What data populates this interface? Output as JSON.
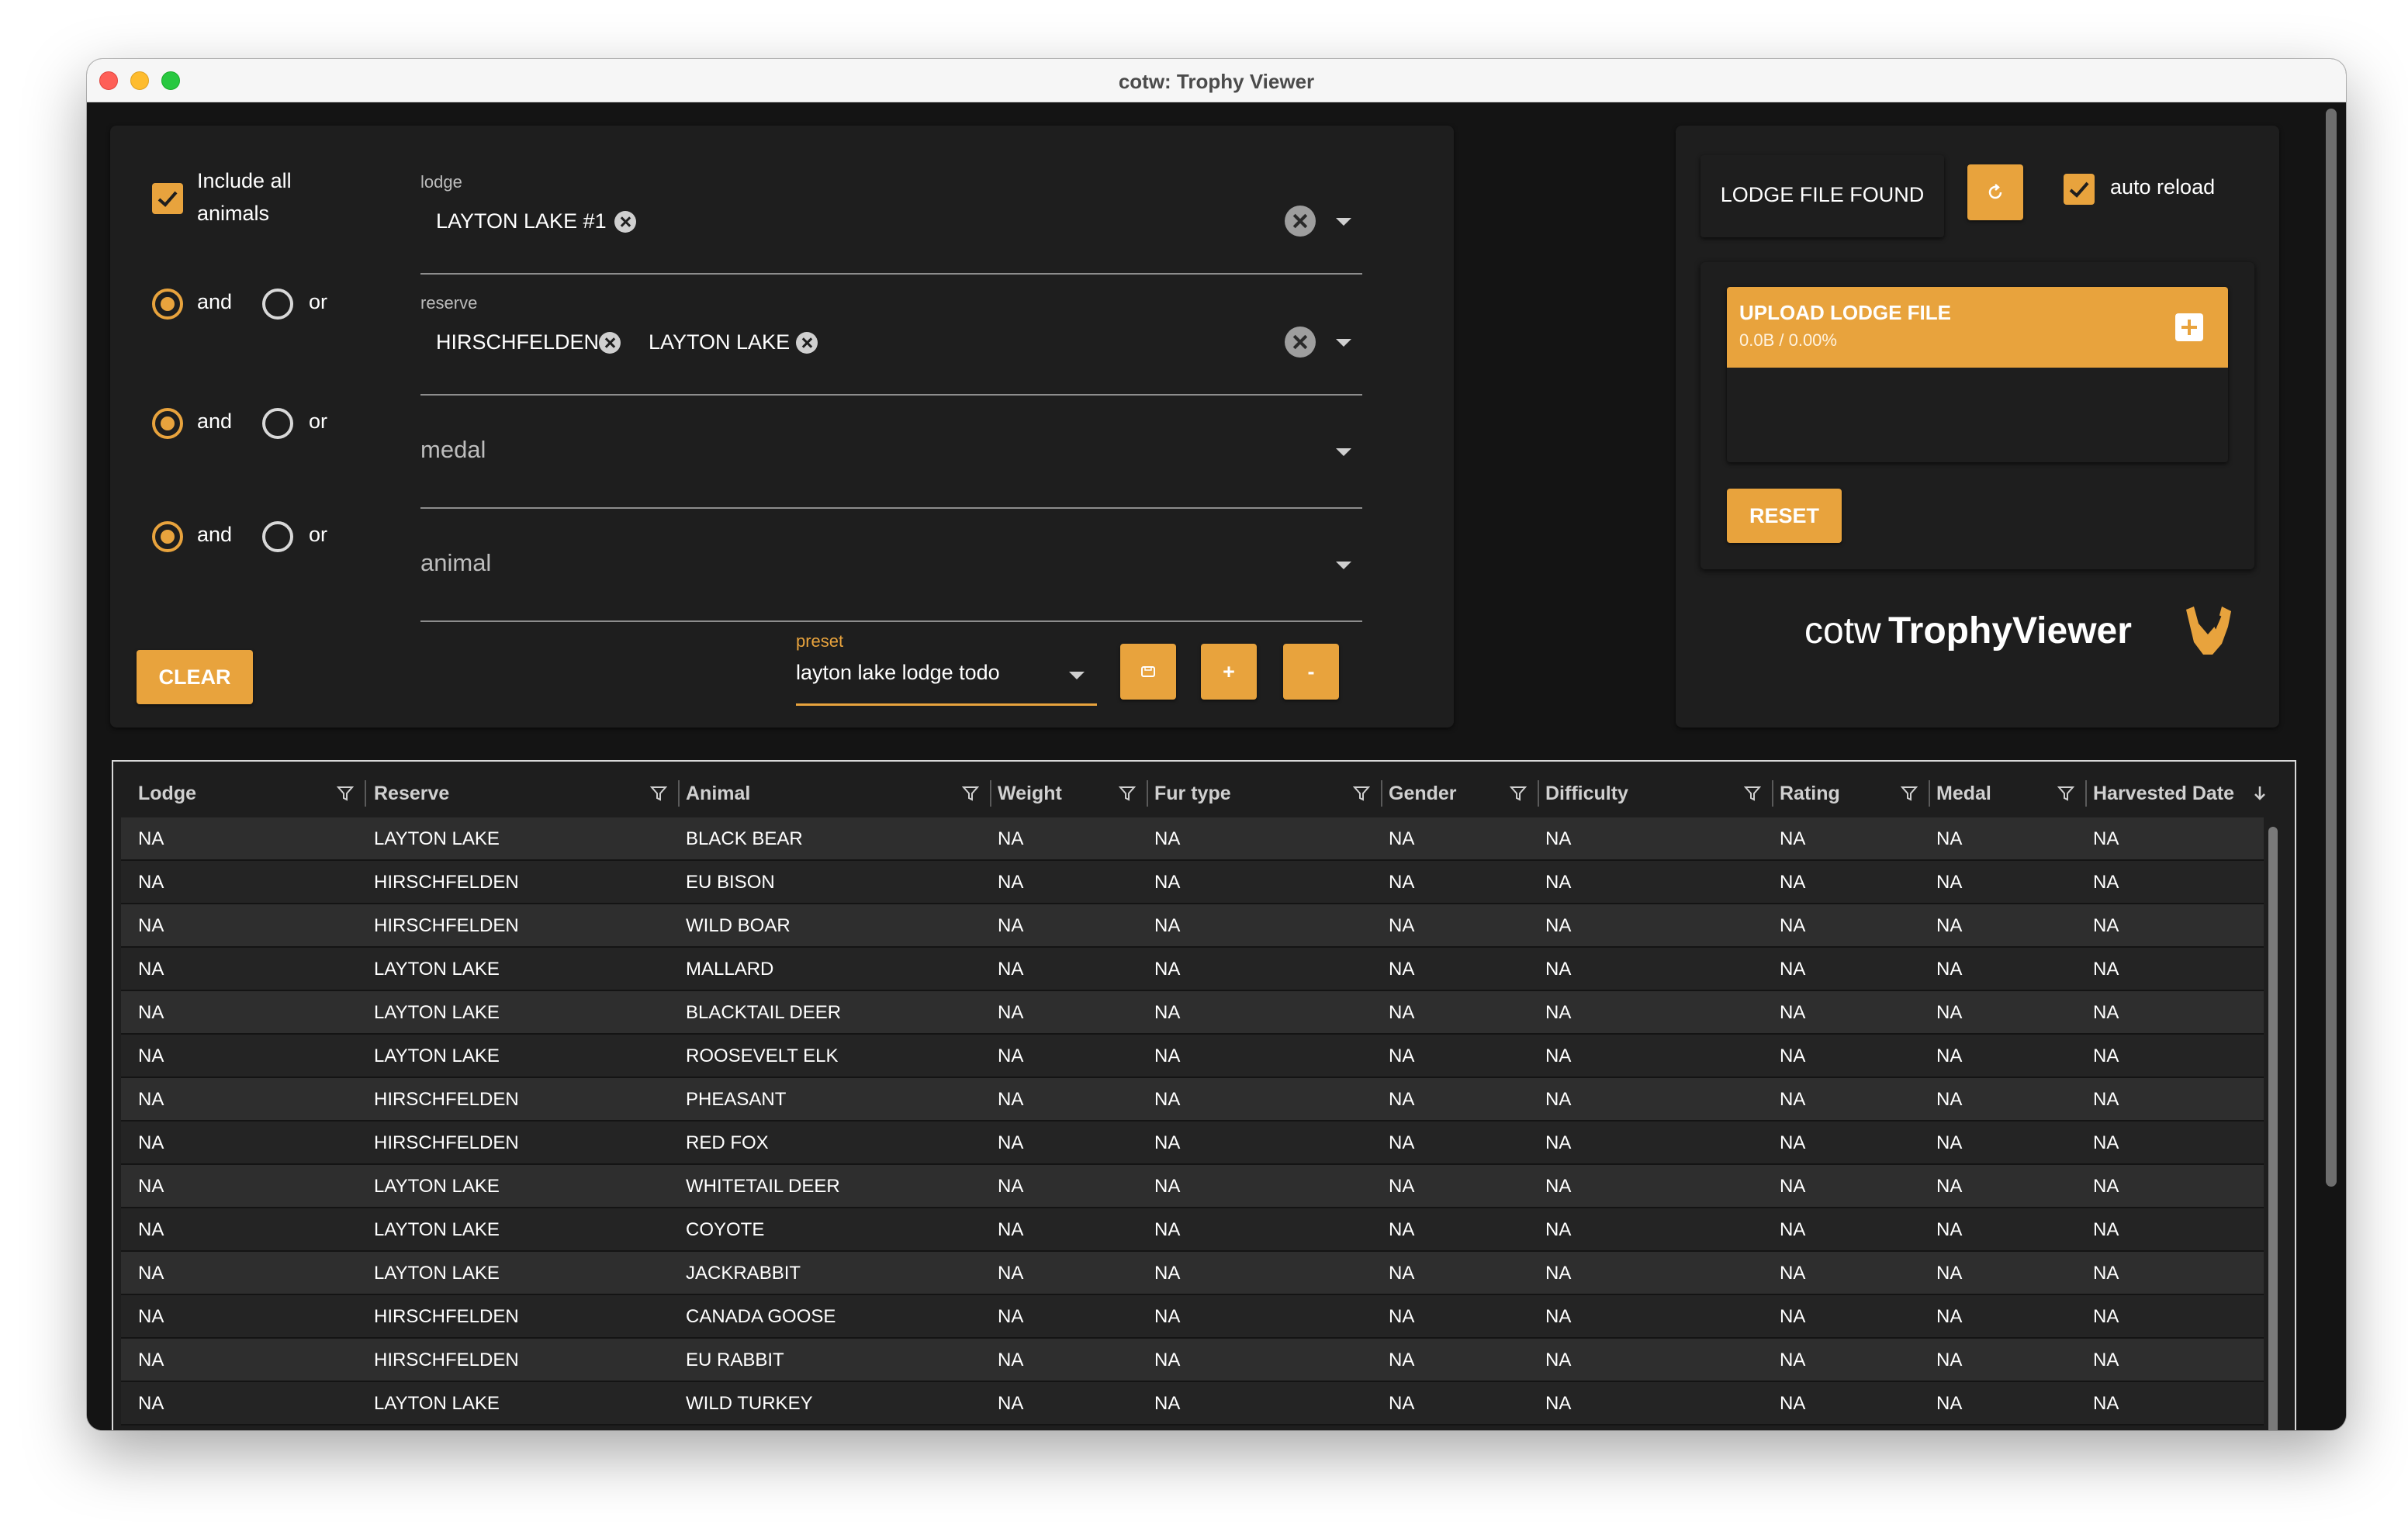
{
  "window": {
    "title": "cotw: Trophy Viewer"
  },
  "filters": {
    "include_all_label_line1": "Include all",
    "include_all_label_line2": "animals",
    "include_all_checked": true,
    "and_label": "and",
    "or_label": "or",
    "lodge": {
      "label": "lodge",
      "chips": [
        "LAYTON LAKE #1"
      ]
    },
    "reserve": {
      "label": "reserve",
      "chips": [
        "HIRSCHFELDEN",
        "LAYTON LAKE"
      ]
    },
    "medal": {
      "placeholder": "medal"
    },
    "animal": {
      "placeholder": "animal"
    },
    "clear_label": "CLEAR",
    "preset": {
      "label": "preset",
      "value": "layton lake lodge todo"
    },
    "save_icon": "save-icon",
    "add_label": "+",
    "remove_label": "-"
  },
  "lodge_panel": {
    "status_label": "LODGE FILE FOUND",
    "refresh_icon": "refresh-icon",
    "auto_reload_label": "auto reload",
    "auto_reload_checked": true,
    "upload_title": "UPLOAD LODGE FILE",
    "upload_progress": "0.0B / 0.00%",
    "reset_label": "RESET",
    "logo_light": "cotw",
    "logo_bold": "TrophyViewer"
  },
  "table": {
    "columns": [
      "Lodge",
      "Reserve",
      "Animal",
      "Weight",
      "Fur type",
      "Gender",
      "Difficulty",
      "Rating",
      "Medal",
      "Harvested Date"
    ],
    "sort_column": "Harvested Date",
    "sort_direction": "descending",
    "rows": [
      [
        "NA",
        "LAYTON LAKE",
        "BLACK BEAR",
        "NA",
        "NA",
        "NA",
        "NA",
        "NA",
        "NA",
        "NA"
      ],
      [
        "NA",
        "HIRSCHFELDEN",
        "EU BISON",
        "NA",
        "NA",
        "NA",
        "NA",
        "NA",
        "NA",
        "NA"
      ],
      [
        "NA",
        "HIRSCHFELDEN",
        "WILD BOAR",
        "NA",
        "NA",
        "NA",
        "NA",
        "NA",
        "NA",
        "NA"
      ],
      [
        "NA",
        "LAYTON LAKE",
        "MALLARD",
        "NA",
        "NA",
        "NA",
        "NA",
        "NA",
        "NA",
        "NA"
      ],
      [
        "NA",
        "LAYTON LAKE",
        "BLACKTAIL DEER",
        "NA",
        "NA",
        "NA",
        "NA",
        "NA",
        "NA",
        "NA"
      ],
      [
        "NA",
        "LAYTON LAKE",
        "ROOSEVELT ELK",
        "NA",
        "NA",
        "NA",
        "NA",
        "NA",
        "NA",
        "NA"
      ],
      [
        "NA",
        "HIRSCHFELDEN",
        "PHEASANT",
        "NA",
        "NA",
        "NA",
        "NA",
        "NA",
        "NA",
        "NA"
      ],
      [
        "NA",
        "HIRSCHFELDEN",
        "RED FOX",
        "NA",
        "NA",
        "NA",
        "NA",
        "NA",
        "NA",
        "NA"
      ],
      [
        "NA",
        "LAYTON LAKE",
        "WHITETAIL DEER",
        "NA",
        "NA",
        "NA",
        "NA",
        "NA",
        "NA",
        "NA"
      ],
      [
        "NA",
        "LAYTON LAKE",
        "COYOTE",
        "NA",
        "NA",
        "NA",
        "NA",
        "NA",
        "NA",
        "NA"
      ],
      [
        "NA",
        "LAYTON LAKE",
        "JACKRABBIT",
        "NA",
        "NA",
        "NA",
        "NA",
        "NA",
        "NA",
        "NA"
      ],
      [
        "NA",
        "HIRSCHFELDEN",
        "CANADA GOOSE",
        "NA",
        "NA",
        "NA",
        "NA",
        "NA",
        "NA",
        "NA"
      ],
      [
        "NA",
        "HIRSCHFELDEN",
        "EU RABBIT",
        "NA",
        "NA",
        "NA",
        "NA",
        "NA",
        "NA",
        "NA"
      ],
      [
        "NA",
        "LAYTON LAKE",
        "WILD TURKEY",
        "NA",
        "NA",
        "NA",
        "NA",
        "NA",
        "NA",
        "NA"
      ]
    ]
  },
  "colors": {
    "accent": "#e8a33d",
    "background": "#141414",
    "card": "#1e1e1e"
  }
}
